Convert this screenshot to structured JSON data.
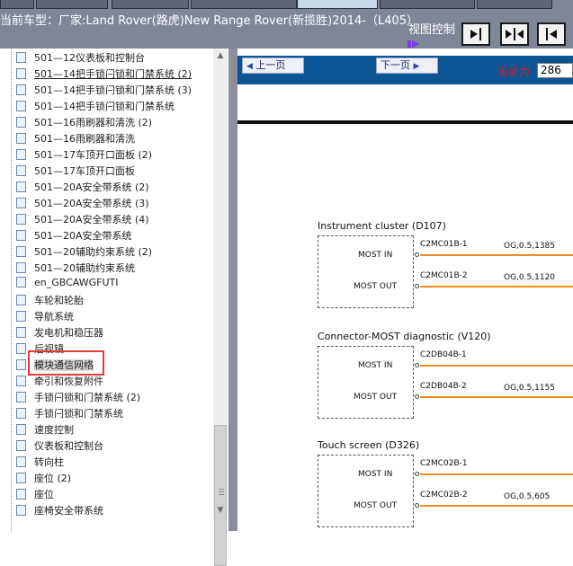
{
  "title": "当前车型：厂家:Land Rover(路虎)New Range Rover(新揽胜)2014-（L405）",
  "view_control": {
    "label": "视图控制",
    "indicator": "▮▶"
  },
  "nav": {
    "prev": "上一页",
    "next": "下一页",
    "current_label": "当前为",
    "current_page": "286"
  },
  "tree": [
    {
      "label": "501—12仪表板和控制台"
    },
    {
      "label": "501—14把手锁闩锁和门禁系统 (2)",
      "underline": true
    },
    {
      "label": "501—14把手锁闩锁和门禁系统 (3)"
    },
    {
      "label": "501—14把手锁闩锁和门禁系统"
    },
    {
      "label": "501—16雨刷器和清洗 (2)"
    },
    {
      "label": "501—16雨刷器和清洗"
    },
    {
      "label": "501—17车顶开口面板 (2)"
    },
    {
      "label": "501—17车顶开口面板"
    },
    {
      "label": "501—20A安全带系统 (2)"
    },
    {
      "label": "501—20A安全带系统 (3)"
    },
    {
      "label": "501—20A安全带系统 (4)"
    },
    {
      "label": "501—20A安全带系统"
    },
    {
      "label": "501—20辅助约束系统 (2)"
    },
    {
      "label": "501—20辅助约束系统"
    },
    {
      "label": "en_GBCAWGFUTI"
    },
    {
      "label": "车轮和轮胎"
    },
    {
      "label": "导航系统"
    },
    {
      "label": "发电机和稳压器"
    },
    {
      "label": "后视镜"
    },
    {
      "label": "模块通信网络",
      "selected": true
    },
    {
      "label": "牵引和恢复附件"
    },
    {
      "label": "手锁闩锁和门禁系统 (2)"
    },
    {
      "label": "手锁闩锁和门禁系统"
    },
    {
      "label": "速度控制"
    },
    {
      "label": "仪表板和控制台"
    },
    {
      "label": "转向柱"
    },
    {
      "label": "座位 (2)"
    },
    {
      "label": "座位"
    },
    {
      "label": "座椅安全带系统"
    }
  ],
  "diagram": {
    "components": [
      {
        "title": "Instrument cluster (D107)",
        "pins": [
          {
            "label": "MOST IN",
            "code": "C2MC01B-1",
            "wire": "OG,0.5,1385"
          },
          {
            "label": "MOST OUT",
            "code": "C2MC01B-2",
            "wire": "OG,0.5,1120"
          }
        ]
      },
      {
        "title": "Connector-MOST diagnostic (V120)",
        "pins": [
          {
            "label": "MOST IN",
            "code": "C2DB04B-1",
            "wire": ""
          },
          {
            "label": "MOST OUT",
            "code": "C2DB04B-2",
            "wire": "OG,0.5,1155"
          }
        ]
      },
      {
        "title": "Touch screen (D326)",
        "pins": [
          {
            "label": "MOST IN",
            "code": "C2MC02B-1",
            "wire": ""
          },
          {
            "label": "MOST OUT",
            "code": "C2MC02B-2",
            "wire": "OG,0.5,605"
          }
        ]
      }
    ]
  },
  "colors": {
    "topbar": "#7f8797",
    "navbar": "#0c5595",
    "wire": "#f08a22",
    "highlight": "#e03b3b",
    "current_label": "#e21a1a"
  }
}
